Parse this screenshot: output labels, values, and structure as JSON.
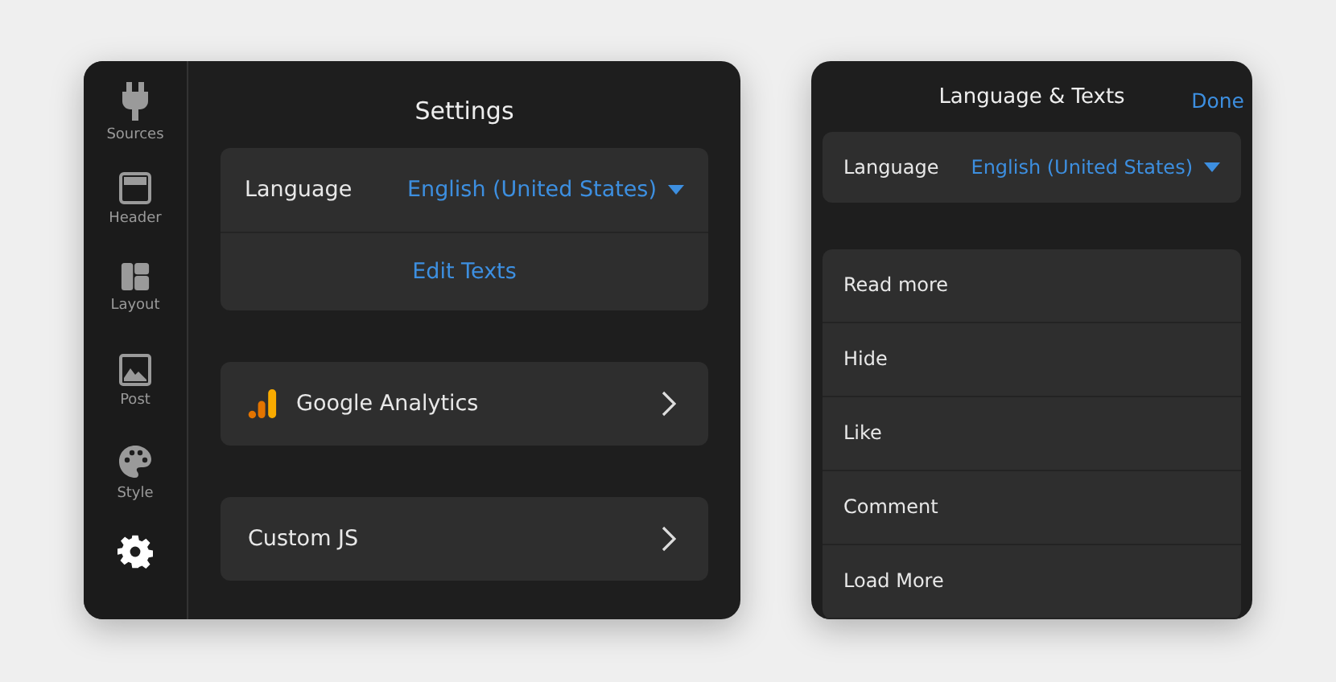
{
  "sidebar": {
    "items": [
      {
        "kind": "plug",
        "label": "Sources",
        "selected": false
      },
      {
        "kind": "header",
        "label": "Header",
        "selected": false
      },
      {
        "kind": "layout",
        "label": "Layout",
        "selected": false
      },
      {
        "kind": "post",
        "label": "Post",
        "selected": false
      },
      {
        "kind": "palette",
        "label": "Style",
        "selected": false
      },
      {
        "kind": "gear",
        "selected": true
      }
    ]
  },
  "settings": {
    "title": "Settings",
    "language": {
      "label": "Language",
      "value": "English (United States)"
    },
    "edit_texts": "Edit Texts",
    "rows": [
      {
        "kind": "analytics",
        "label": "Google Analytics"
      },
      {
        "kind": "plain",
        "label": "Custom JS"
      }
    ]
  },
  "texts_panel": {
    "title": "Language & Texts",
    "done": "Done",
    "language": {
      "label": "Language",
      "value": "English (United States)"
    },
    "items": [
      "Read more",
      "Hide",
      "Like",
      "Comment",
      "Load More"
    ]
  }
}
